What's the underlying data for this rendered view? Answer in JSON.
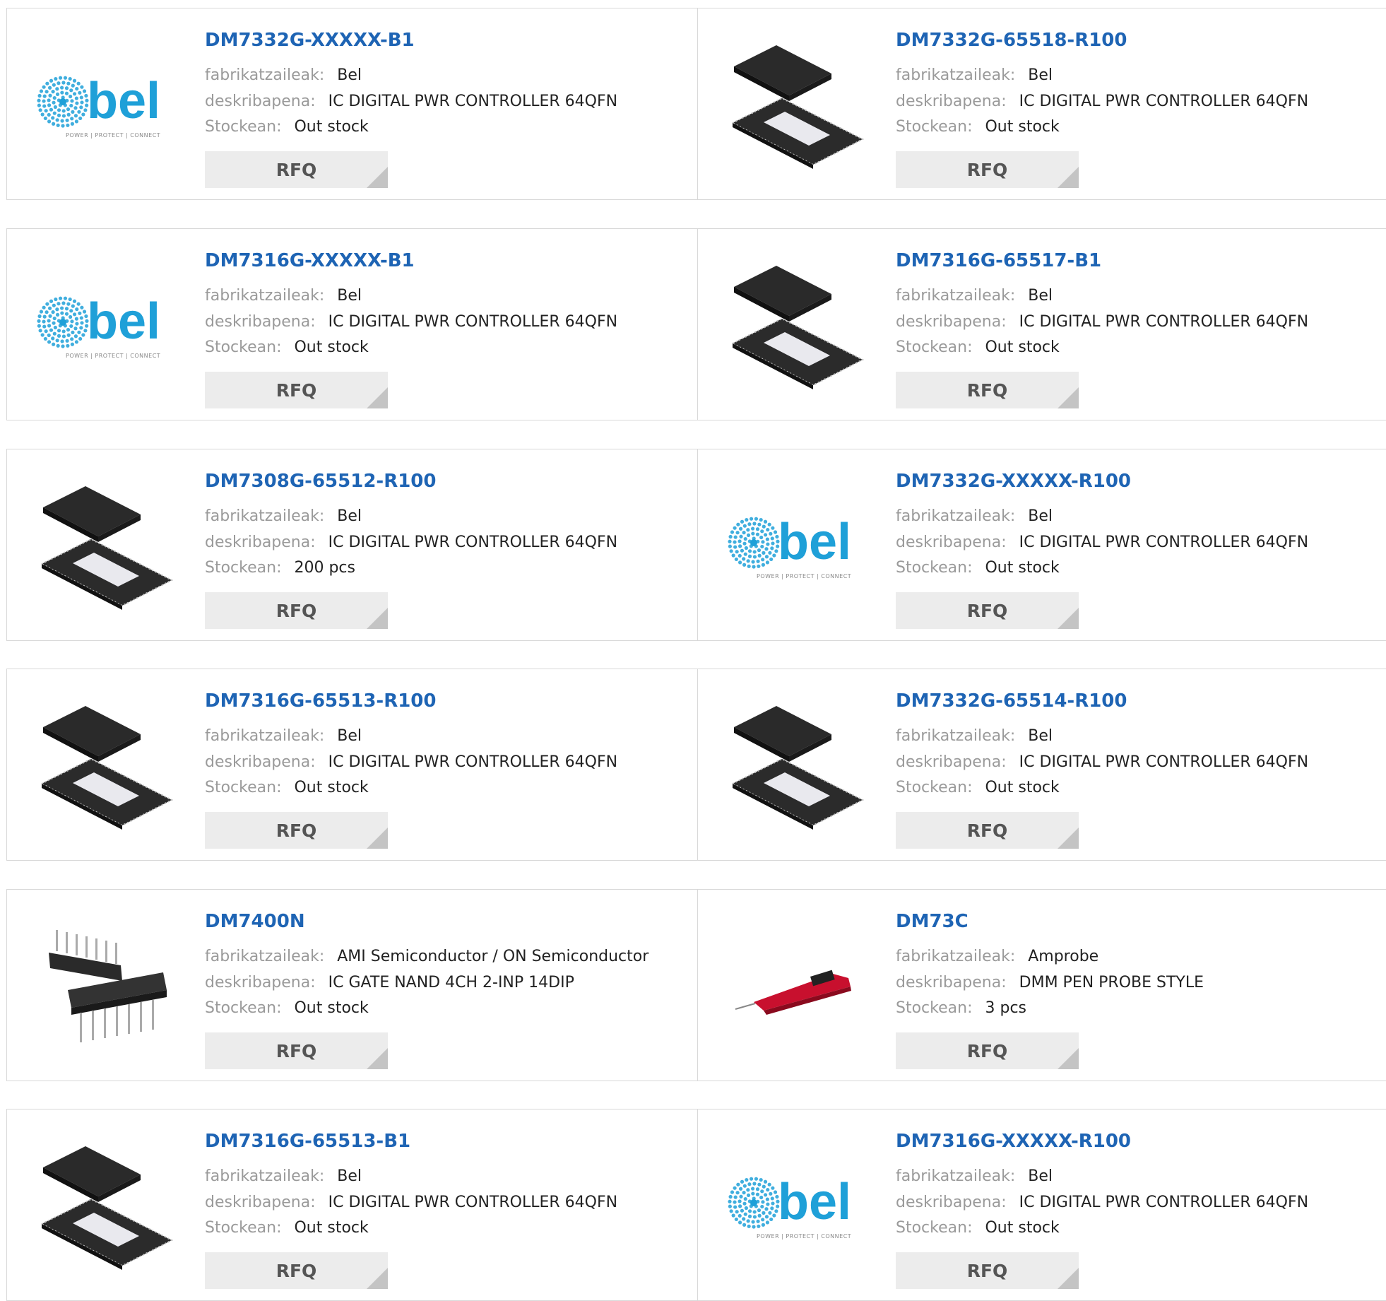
{
  "labels": {
    "manufacturer": "fabrikatzaileak:",
    "description": "deskribapena:",
    "stock": "Stockean:",
    "rfq": "RFQ"
  },
  "colors": {
    "part_link": "#1e64b4",
    "label": "#9a9a9a",
    "rfq_bg": "#ececec",
    "bel_brand": "#1fa0d8"
  },
  "products": [
    {
      "part": "DM7332G-XXXXX-B1",
      "manufacturer": "Bel",
      "description": "IC DIGITAL PWR CONTROLLER 64QFN",
      "stock": "Out stock",
      "image": "bel-logo",
      "logo_text": "bel",
      "logo_tagline": "POWER | PROTECT | CONNECT"
    },
    {
      "part": "DM7332G-65518-R100",
      "manufacturer": "Bel",
      "description": "IC DIGITAL PWR CONTROLLER 64QFN",
      "stock": "Out stock",
      "image": "qfn-chip"
    },
    {
      "part": "DM7316G-XXXXX-B1",
      "manufacturer": "Bel",
      "description": "IC DIGITAL PWR CONTROLLER 64QFN",
      "stock": "Out stock",
      "image": "bel-logo",
      "logo_text": "bel",
      "logo_tagline": "POWER | PROTECT | CONNECT"
    },
    {
      "part": "DM7316G-65517-B1",
      "manufacturer": "Bel",
      "description": "IC DIGITAL PWR CONTROLLER 64QFN",
      "stock": "Out stock",
      "image": "qfn-chip"
    },
    {
      "part": "DM7308G-65512-R100",
      "manufacturer": "Bel",
      "description": "IC DIGITAL PWR CONTROLLER 64QFN",
      "stock": "200 pcs",
      "image": "qfn-chip"
    },
    {
      "part": "DM7332G-XXXXX-R100",
      "manufacturer": "Bel",
      "description": "IC DIGITAL PWR CONTROLLER 64QFN",
      "stock": "Out stock",
      "image": "bel-logo",
      "logo_text": "bel",
      "logo_tagline": "POWER | PROTECT | CONNECT"
    },
    {
      "part": "DM7316G-65513-R100",
      "manufacturer": "Bel",
      "description": "IC DIGITAL PWR CONTROLLER 64QFN",
      "stock": "Out stock",
      "image": "qfn-chip"
    },
    {
      "part": "DM7332G-65514-R100",
      "manufacturer": "Bel",
      "description": "IC DIGITAL PWR CONTROLLER 64QFN",
      "stock": "Out stock",
      "image": "qfn-chip"
    },
    {
      "part": "DM7400N",
      "manufacturer": "AMI Semiconductor / ON Semiconductor",
      "description": "IC GATE NAND 4CH 2-INP 14DIP",
      "stock": "Out stock",
      "image": "dip-chip"
    },
    {
      "part": "DM73C",
      "manufacturer": "Amprobe",
      "description": "DMM PEN PROBE STYLE",
      "stock": "3 pcs",
      "image": "pen-multimeter"
    },
    {
      "part": "DM7316G-65513-B1",
      "manufacturer": "Bel",
      "description": "IC DIGITAL PWR CONTROLLER 64QFN",
      "stock": "Out stock",
      "image": "qfn-chip"
    },
    {
      "part": "DM7316G-XXXXX-R100",
      "manufacturer": "Bel",
      "description": "IC DIGITAL PWR CONTROLLER 64QFN",
      "stock": "Out stock",
      "image": "bel-logo",
      "logo_text": "bel",
      "logo_tagline": "POWER | PROTECT | CONNECT"
    }
  ]
}
